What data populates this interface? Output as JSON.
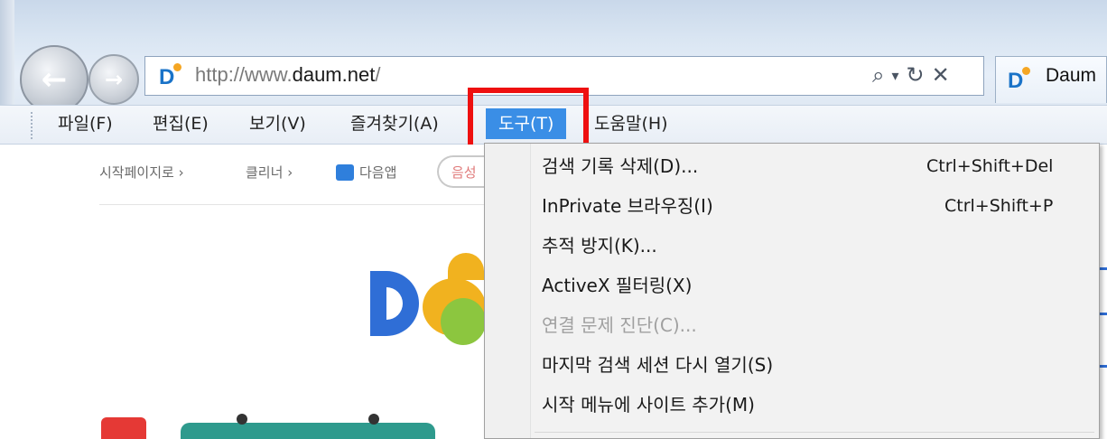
{
  "browser": {
    "url_prefix": "http://www.",
    "url_domain": "daum.net",
    "url_suffix": "/",
    "tab_title": "Daum",
    "address_icons": {
      "search": "⌕",
      "dropdown": "▾",
      "refresh": "↻",
      "stop": "✕"
    },
    "back_glyph": "←",
    "forward_glyph": "→"
  },
  "menubar": {
    "items": [
      {
        "label": "파일(F)"
      },
      {
        "label": "편집(E)"
      },
      {
        "label": "보기(V)"
      },
      {
        "label": "즐겨찾기(A)"
      },
      {
        "label": "도구(T)"
      },
      {
        "label": "도움말(H)"
      }
    ],
    "active_index": 4,
    "active_color": "#3a8ee6",
    "highlight_color": "#ee1010"
  },
  "page": {
    "toolbar": {
      "start_page": "시작페이지로",
      "cleaner": "클리너",
      "daum_app": "다음앱",
      "pill_text": "음성",
      "chevron": "›"
    },
    "logo_colors": {
      "blue": "#2f6ed6",
      "yellow": "#f1b21f",
      "green": "#8cc63f"
    }
  },
  "tools_menu": {
    "items": [
      {
        "label": "검색 기록 삭제(D)...",
        "shortcut": "Ctrl+Shift+Del",
        "enabled": true
      },
      {
        "label": "InPrivate 브라우징(I)",
        "shortcut": "Ctrl+Shift+P",
        "enabled": true
      },
      {
        "label": "추적 방지(K)...",
        "shortcut": "",
        "enabled": true
      },
      {
        "label": "ActiveX 필터링(X)",
        "shortcut": "",
        "enabled": true
      },
      {
        "label": "연결 문제 진단(C)...",
        "shortcut": "",
        "enabled": false
      },
      {
        "label": "마지막 검색 세션 다시 열기(S)",
        "shortcut": "",
        "enabled": true
      },
      {
        "label": "시작 메뉴에 사이트 추가(M)",
        "shortcut": "",
        "enabled": true
      }
    ]
  }
}
